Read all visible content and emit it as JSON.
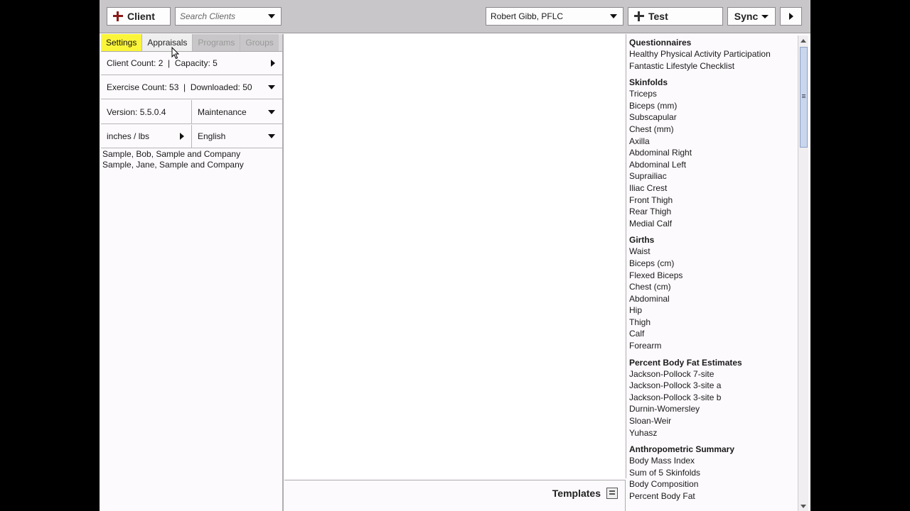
{
  "toolbar": {
    "client_label": "Client",
    "search_placeholder": "Search Clients",
    "trainer": "Robert Gibb, PFLC",
    "test_label": "Test",
    "sync_label": "Sync"
  },
  "tabs": [
    "Settings",
    "Appraisals",
    "Programs",
    "Groups"
  ],
  "settings": {
    "client_count": "Client Count: 2  |  Capacity: 5",
    "exercise_count": "Exercise Count: 53  |  Downloaded: 50",
    "version": "Version: 5.5.0.4",
    "maintenance": "Maintenance",
    "units": "inches / lbs",
    "language": "English"
  },
  "clients": [
    "Sample, Bob, Sample and Company",
    "Sample, Jane, Sample and Company"
  ],
  "footer": {
    "templates_label": "Templates"
  },
  "groups": [
    {
      "title": "Questionnaires",
      "items": [
        "Healthy Physical Activity Participation",
        "Fantastic Lifestyle Checklist"
      ]
    },
    {
      "title": "Skinfolds",
      "items": [
        "Triceps",
        "Biceps (mm)",
        "Subscapular",
        "Chest (mm)",
        "Axilla",
        "Abdominal Right",
        "Abdominal Left",
        "Suprailiac",
        "Iliac Crest",
        "Front Thigh",
        "Rear Thigh",
        "Medial Calf"
      ]
    },
    {
      "title": "Girths",
      "items": [
        "Waist",
        "Biceps (cm)",
        "Flexed Biceps",
        "Chest (cm)",
        "Abdominal",
        "Hip",
        "Thigh",
        "Calf",
        "Forearm"
      ]
    },
    {
      "title": "Percent Body Fat Estimates",
      "items": [
        "Jackson-Pollock 7-site",
        "Jackson-Pollock 3-site a",
        "Jackson-Pollock 3-site b",
        "Durnin-Womersley",
        "Sloan-Weir",
        "Yuhasz"
      ]
    },
    {
      "title": "Anthropometric Summary",
      "items": [
        "Body Mass Index",
        "Sum of 5 Skinfolds",
        "Body Composition",
        "Percent Body Fat"
      ]
    }
  ],
  "colors": {
    "active_tab": "#fbf53a",
    "plus_red": "#8b1a1a",
    "toolbar": "#c9c6c9"
  }
}
